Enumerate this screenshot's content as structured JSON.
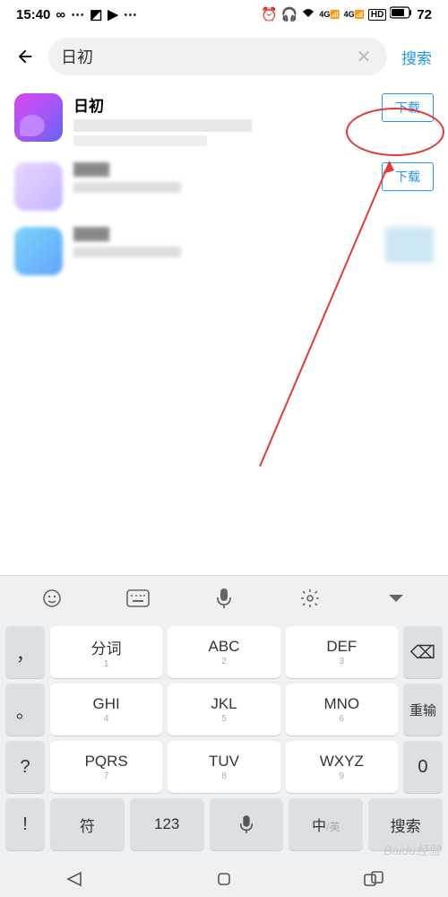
{
  "status": {
    "time": "15:40",
    "battery": "72"
  },
  "search": {
    "query": "日初",
    "action": "搜索"
  },
  "results": [
    {
      "name": "日初",
      "download": "下载"
    },
    {
      "name": "",
      "download": "下载"
    },
    {
      "name": "",
      "download": ""
    }
  ],
  "keyboard": {
    "rows": [
      [
        {
          "side": "，"
        },
        {
          "label": "分词",
          "num": "1"
        },
        {
          "label": "ABC",
          "num": "2"
        },
        {
          "label": "DEF",
          "num": "3"
        },
        {
          "side": "⌫",
          "gray": true
        }
      ],
      [
        {
          "side": "。"
        },
        {
          "label": "GHI",
          "num": "4"
        },
        {
          "label": "JKL",
          "num": "5"
        },
        {
          "label": "MNO",
          "num": "6"
        },
        {
          "side": "重输",
          "gray": true,
          "text": true
        }
      ],
      [
        {
          "side": "?"
        },
        {
          "label": "PQRS",
          "num": "7"
        },
        {
          "label": "TUV",
          "num": "8"
        },
        {
          "label": "WXYZ",
          "num": "9"
        },
        {
          "side": "0",
          "gray": true
        }
      ],
      [
        {
          "side": "!"
        },
        {
          "label": "符",
          "gray": true
        },
        {
          "label": "123",
          "gray": true
        },
        {
          "label": "mic",
          "gray": true,
          "icon": true
        },
        {
          "label": "中",
          "sub": "/英",
          "gray": true,
          "lang": true
        },
        {
          "label": "搜索",
          "gray": true
        }
      ]
    ]
  },
  "watermark": "Baidu经验"
}
